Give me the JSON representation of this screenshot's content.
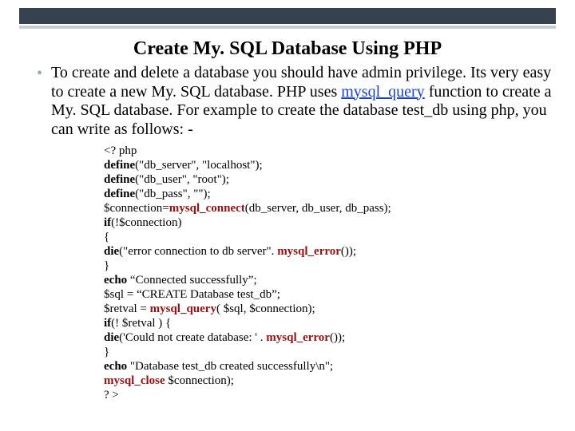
{
  "title": "Create My. SQL Database Using PHP",
  "bullet": {
    "pre": "To create and delete a database you should have admin privilege. Its very easy to create a new My. SQL database. PHP uses ",
    "link": "mysql_query",
    "post": " function to create a My. SQL database. For example to create the database test_db using php, you can write as follows: -"
  },
  "code": {
    "l1": "<? php",
    "l2a": "define",
    "l2b": "(\"db_server\", \"localhost\");",
    "l3a": "define",
    "l3b": "(\"db_user\", \"root\");",
    "l4a": "define",
    "l4b": "(\"db_pass\", \"\");",
    "l5a": "$connection=",
    "l5b": "mysql_connect",
    "l5c": "(db_server, db_user, db_pass);",
    "l6a": "if",
    "l6b": "(!$connection)",
    "l7": "{",
    "l8a": "die",
    "l8b": "(\"error connection to db server\". ",
    "l8c": "mysql_error",
    "l8d": "());",
    "l9": "}",
    "l10a": "echo ",
    "l10b": "“Connected successfully”;",
    "l11": "$sql = “CREATE Database test_db”;",
    "l12a": "$retval = ",
    "l12b": "mysql_query",
    "l12c": "( $sql, $connection);",
    "l13a": " if",
    "l13b": "(! $retval ) {",
    "l14a": "die",
    "l14b": "('Could not create database: ' . ",
    "l14c": "mysql_error",
    "l14d": "());",
    "l15": "}",
    "l16a": "echo ",
    "l16b": "\"Database test_db created successfully\\n\";",
    "l17a": "mysql_close ",
    "l17b": "$connection);",
    "l18": "? >"
  }
}
